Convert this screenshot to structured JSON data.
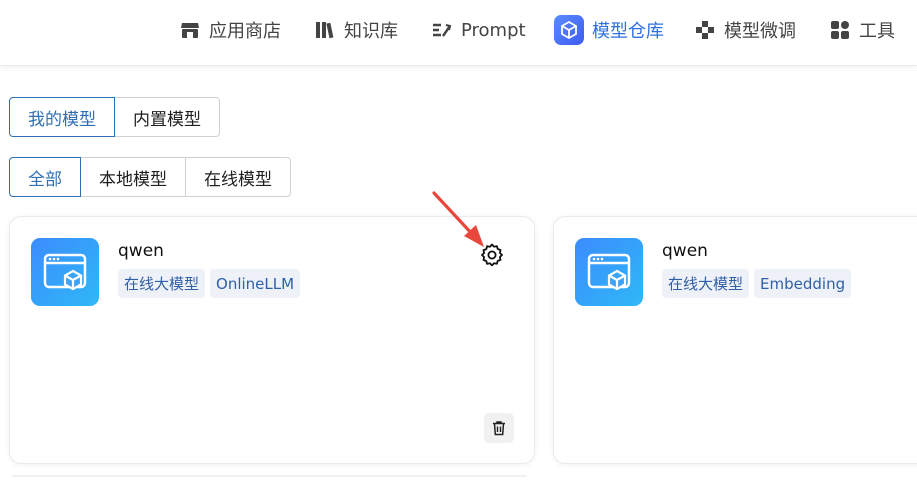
{
  "nav": {
    "items": [
      {
        "label": "应用商店",
        "icon": "store-icon"
      },
      {
        "label": "知识库",
        "icon": "library-icon"
      },
      {
        "label": "Prompt",
        "icon": "prompt-icon"
      },
      {
        "label": "模型仓库",
        "icon": "cube-icon",
        "active": true
      },
      {
        "label": "模型微调",
        "icon": "puzzle-icon"
      },
      {
        "label": "工具",
        "icon": "apps-icon"
      }
    ]
  },
  "tabs_primary": {
    "items": [
      "我的模型",
      "内置模型"
    ],
    "active": "我的模型"
  },
  "tabs_filter": {
    "items": [
      "全部",
      "本地模型",
      "在线模型"
    ],
    "active": "全部"
  },
  "models": [
    {
      "name": "qwen",
      "tags": [
        "在线大模型",
        "OnlineLLM"
      ]
    },
    {
      "name": "qwen",
      "tags": [
        "在线大模型",
        "Embedding"
      ]
    }
  ],
  "colors": {
    "accent": "#2f6fb3",
    "nav_active": "#2f6fe0",
    "annotation_arrow": "#e8473c"
  }
}
